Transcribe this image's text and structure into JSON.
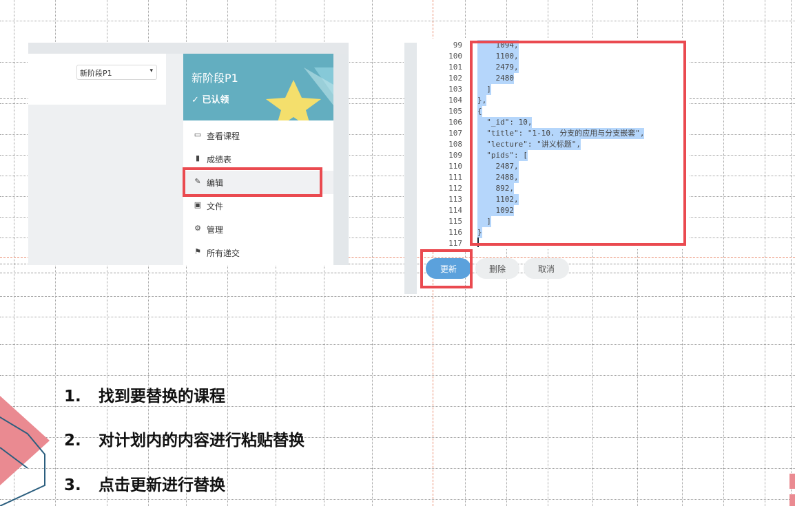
{
  "left_panel": {
    "stage_select": {
      "value": "新阶段P1"
    },
    "card": {
      "title": "新阶段P1",
      "claimed": "✓ 已认领"
    },
    "menu": [
      {
        "icon": "hard-drive-icon",
        "label": "查看课程"
      },
      {
        "icon": "bar-chart-icon",
        "label": "成绩表"
      },
      {
        "icon": "pencil-icon",
        "label": "编辑"
      },
      {
        "icon": "image-icon",
        "label": "文件"
      },
      {
        "icon": "gear-icon",
        "label": "管理"
      },
      {
        "icon": "flag-icon",
        "label": "所有递交"
      }
    ]
  },
  "editor": {
    "line_numbers": [
      "99",
      "100",
      "101",
      "102",
      "103",
      "104",
      "105",
      "106",
      "107",
      "108",
      "109",
      "110",
      "111",
      "112",
      "113",
      "114",
      "115",
      "116",
      "117"
    ],
    "lines": [
      "    1094,",
      "    1100,",
      "    2479,",
      "    2480",
      "  ]",
      "},",
      "{",
      "  \"_id\": 10,",
      "  \"title\": \"1-10. 分支的应用与分支嵌套\",",
      "  \"lecture\": \"讲义标题\",",
      "  \"pids\": [",
      "    2487,",
      "    2488,",
      "    892,",
      "    1102,",
      "    1092",
      "  ]",
      "}",
      ""
    ]
  },
  "buttons": {
    "update": "更新",
    "delete": "删除",
    "cancel": "取消"
  },
  "steps": [
    {
      "num": "1.",
      "text": "找到要替换的课程"
    },
    {
      "num": "2.",
      "text": "对计划内的内容进行粘贴替换"
    },
    {
      "num": "3.",
      "text": "点击更新进行替换"
    }
  ],
  "colors": {
    "annotation_red": "#ea4a50",
    "card_header": "#63aec0",
    "update_button": "#5ba1dc",
    "selection": "#b5d6fb"
  }
}
